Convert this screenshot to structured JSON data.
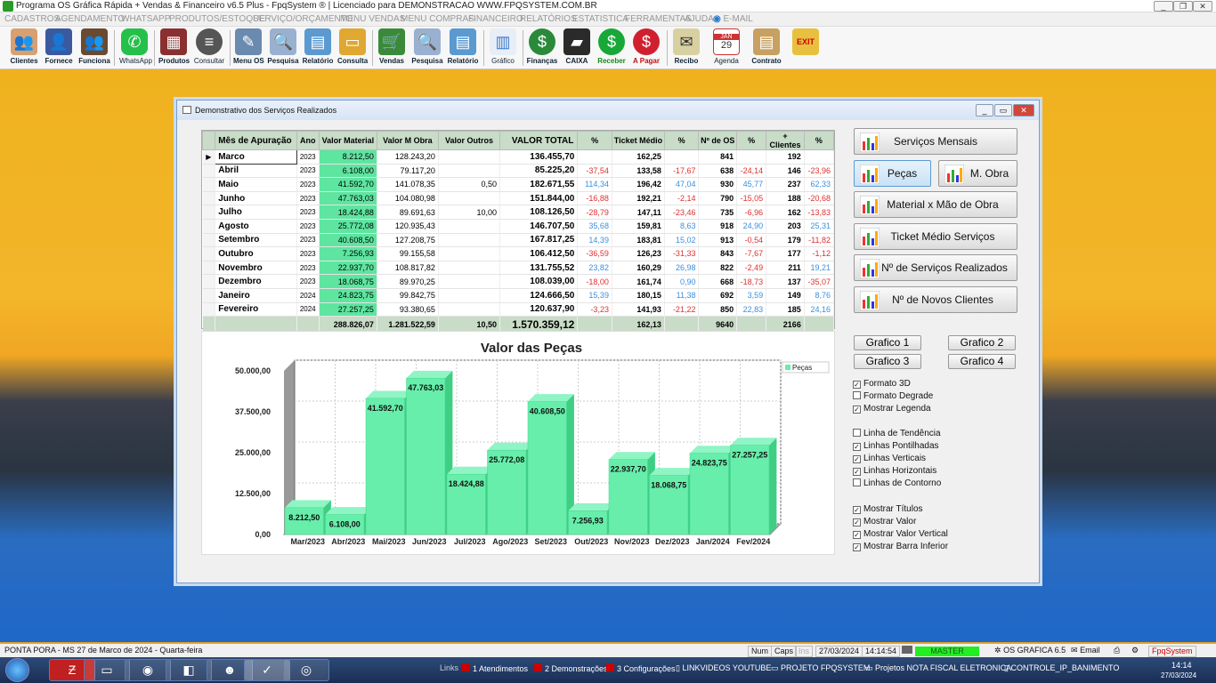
{
  "app": {
    "title": "Programa OS Gráfica Rápida + Vendas & Financeiro v6.5 Plus - FpqSystem ® | Licenciado para  DEMONSTRACAO WWW.FPQSYSTEM.COM.BR"
  },
  "menu": [
    "CADASTROS",
    "AGENDAMENTO",
    "WHATSAPP",
    "PRODUTOS/ESTOQUE",
    "SERVIÇO/ORÇAMENTO",
    "MENU VENDAS",
    "MENU COMPRAS",
    "FINANCEIRO",
    "RELATÓRIOS",
    "ESTATISTICA",
    "FERRAMENTAS",
    "AJUDA",
    "E-MAIL"
  ],
  "toolbar": [
    "Clientes",
    "Fornece",
    "Funciona",
    "WhatsApp",
    "Produtos",
    "Consultar",
    "Menu OS",
    "Pesquisa",
    "Relatório",
    "Consulta",
    "Vendas",
    "Pesquisa",
    "Relatório",
    "Gráfico",
    "Finanças",
    "CAIXA",
    "Receber",
    "A Pagar",
    "Recibo",
    "Agenda",
    "Contrato"
  ],
  "toolbar_icons": [
    "clients-icon",
    "supplier-icon",
    "employees-icon",
    "whatsapp-icon",
    "products-icon",
    "search-icon",
    "os-menu-icon",
    "search-doc-icon",
    "report-icon",
    "folder-icon",
    "cart-icon",
    "search-doc-icon",
    "report-icon",
    "chart-icon",
    "finance-icon",
    "cash-icon",
    "receive-icon",
    "pay-icon",
    "receipt-icon",
    "calendar-icon",
    "contract-icon",
    "exit-icon"
  ],
  "calendar": {
    "month": "JAN",
    "day": "29"
  },
  "window": {
    "title": "Demonstrativo dos Serviços Realizados"
  },
  "table": {
    "headers": [
      "Mês de Apuração",
      "Ano",
      "Valor Material",
      "Valor M Obra",
      "Valor Outros",
      "VALOR TOTAL",
      "%",
      "Ticket Médio",
      "%",
      "Nº de OS",
      "%",
      "+ Clientes",
      "%"
    ],
    "rows": [
      [
        "Marco",
        "2023",
        "8.212,50",
        "128.243,20",
        "",
        "136.455,70",
        "",
        "162,25",
        "",
        "841",
        "",
        "192",
        ""
      ],
      [
        "Abril",
        "2023",
        "6.108,00",
        "79.117,20",
        "",
        "85.225,20",
        "-37,54",
        "133,58",
        "-17,67",
        "638",
        "-24,14",
        "146",
        "-23,96"
      ],
      [
        "Maio",
        "2023",
        "41.592,70",
        "141.078,35",
        "0,50",
        "182.671,55",
        "114,34",
        "196,42",
        "47,04",
        "930",
        "45,77",
        "237",
        "62,33"
      ],
      [
        "Junho",
        "2023",
        "47.763,03",
        "104.080,98",
        "",
        "151.844,00",
        "-16,88",
        "192,21",
        "-2,14",
        "790",
        "-15,05",
        "188",
        "-20,68"
      ],
      [
        "Julho",
        "2023",
        "18.424,88",
        "89.691,63",
        "10,00",
        "108.126,50",
        "-28,79",
        "147,11",
        "-23,46",
        "735",
        "-6,96",
        "162",
        "-13,83"
      ],
      [
        "Agosto",
        "2023",
        "25.772,08",
        "120.935,43",
        "",
        "146.707,50",
        "35,68",
        "159,81",
        "8,63",
        "918",
        "24,90",
        "203",
        "25,31"
      ],
      [
        "Setembro",
        "2023",
        "40.608,50",
        "127.208,75",
        "",
        "167.817,25",
        "14,39",
        "183,81",
        "15,02",
        "913",
        "-0,54",
        "179",
        "-11,82"
      ],
      [
        "Outubro",
        "2023",
        "7.256,93",
        "99.155,58",
        "",
        "106.412,50",
        "-36,59",
        "126,23",
        "-31,33",
        "843",
        "-7,67",
        "177",
        "-1,12"
      ],
      [
        "Novembro",
        "2023",
        "22.937,70",
        "108.817,82",
        "",
        "131.755,52",
        "23,82",
        "160,29",
        "26,98",
        "822",
        "-2,49",
        "211",
        "19,21"
      ],
      [
        "Dezembro",
        "2023",
        "18.068,75",
        "89.970,25",
        "",
        "108.039,00",
        "-18,00",
        "161,74",
        "0,90",
        "668",
        "-18,73",
        "137",
        "-35,07"
      ],
      [
        "Janeiro",
        "2024",
        "24.823,75",
        "99.842,75",
        "",
        "124.666,50",
        "15,39",
        "180,15",
        "11,38",
        "692",
        "3,59",
        "149",
        "8,76"
      ],
      [
        "Fevereiro",
        "2024",
        "27.257,25",
        "93.380,65",
        "",
        "120.637,90",
        "-3,23",
        "141,93",
        "-21,22",
        "850",
        "22,83",
        "185",
        "24,16"
      ]
    ],
    "footer": [
      "",
      "",
      "288.826,07",
      "1.281.522,59",
      "10,50",
      "1.570.359,12",
      "",
      "162,13",
      "",
      "9640",
      "",
      "2166",
      ""
    ]
  },
  "chart_data": {
    "type": "bar",
    "title": "Valor das Peças",
    "categories": [
      "Mar/2023",
      "Abr/2023",
      "Mai/2023",
      "Jun/2023",
      "Jul/2023",
      "Ago/2023",
      "Set/2023",
      "Out/2023",
      "Nov/2023",
      "Dez/2023",
      "Jan/2024",
      "Fev/2024"
    ],
    "series": [
      {
        "name": "Peças",
        "values": [
          8212.5,
          6108.0,
          41592.7,
          47763.03,
          18424.88,
          25772.08,
          40608.5,
          7256.93,
          22937.7,
          18068.75,
          24823.75,
          27257.25
        ]
      }
    ],
    "value_labels": [
      "8.212,50",
      "6.108,00",
      "41.592,70",
      "47.763,03",
      "18.424,88",
      "25.772,08",
      "40.608,50",
      "7.256,93",
      "22.937,70",
      "18.068,75",
      "24.823,75",
      "27.257,25"
    ],
    "yticks": [
      "0,00",
      "12.500,00",
      "25.000,00",
      "37.500,00",
      "50.000,00"
    ],
    "ylim": [
      0,
      50000
    ],
    "legend": "top-right",
    "grid": true,
    "color": "#66eeaa"
  },
  "right_buttons": {
    "servicos_mensais": "Serviços Mensais",
    "pecas": "Peças",
    "mobra": "M. Obra",
    "material_mao": "Material x Mão de Obra",
    "ticket": "Ticket Médio Serviços",
    "num_servicos": "Nº de Serviços Realizados",
    "novos_clientes": "Nº de Novos Clientes"
  },
  "grafico_buttons": [
    "Grafico 1",
    "Grafico 2",
    "Grafico 3",
    "Grafico 4"
  ],
  "options": [
    {
      "label": "Formato 3D",
      "checked": true
    },
    {
      "label": "Formato Degrade",
      "checked": false
    },
    {
      "label": "Mostrar Legenda",
      "checked": true
    },
    {
      "label": "Linha de Tendência",
      "checked": false
    },
    {
      "label": "Linhas Pontilhadas",
      "checked": true
    },
    {
      "label": "Linhas Verticais",
      "checked": true
    },
    {
      "label": "Linhas Horizontais",
      "checked": true
    },
    {
      "label": "Linhas de Contorno",
      "checked": false
    },
    {
      "label": "Mostrar Títulos",
      "checked": true
    },
    {
      "label": "Mostrar Valor",
      "checked": true
    },
    {
      "label": "Mostrar Valor Vertical",
      "checked": true
    },
    {
      "label": "Mostrar Barra Inferior",
      "checked": true
    }
  ],
  "status": {
    "location": "PONTA PORA - MS 27 de Marco de 2024 - Quarta-feira",
    "num": "Num",
    "caps": "Caps",
    "ins": "Ins",
    "date": "27/03/2024",
    "time": "14:14:54",
    "user": "MASTER",
    "version": "OS GRAFICA 6.5",
    "email": "Email",
    "brand": "FpqSystem"
  },
  "taskbar": {
    "links_label": "Links",
    "links": [
      "1 Atendimentos",
      "2 Demonstrações",
      "3 Configurações",
      "LINKVIDEOS YOUTUBE",
      "PROJETO FPQSYSTEM",
      "Projetos NOTA FISCAL ELETRONICA",
      "CONTROLE_IP_BANIMENTO"
    ],
    "time": "14:14",
    "date": "27/03/2024"
  }
}
